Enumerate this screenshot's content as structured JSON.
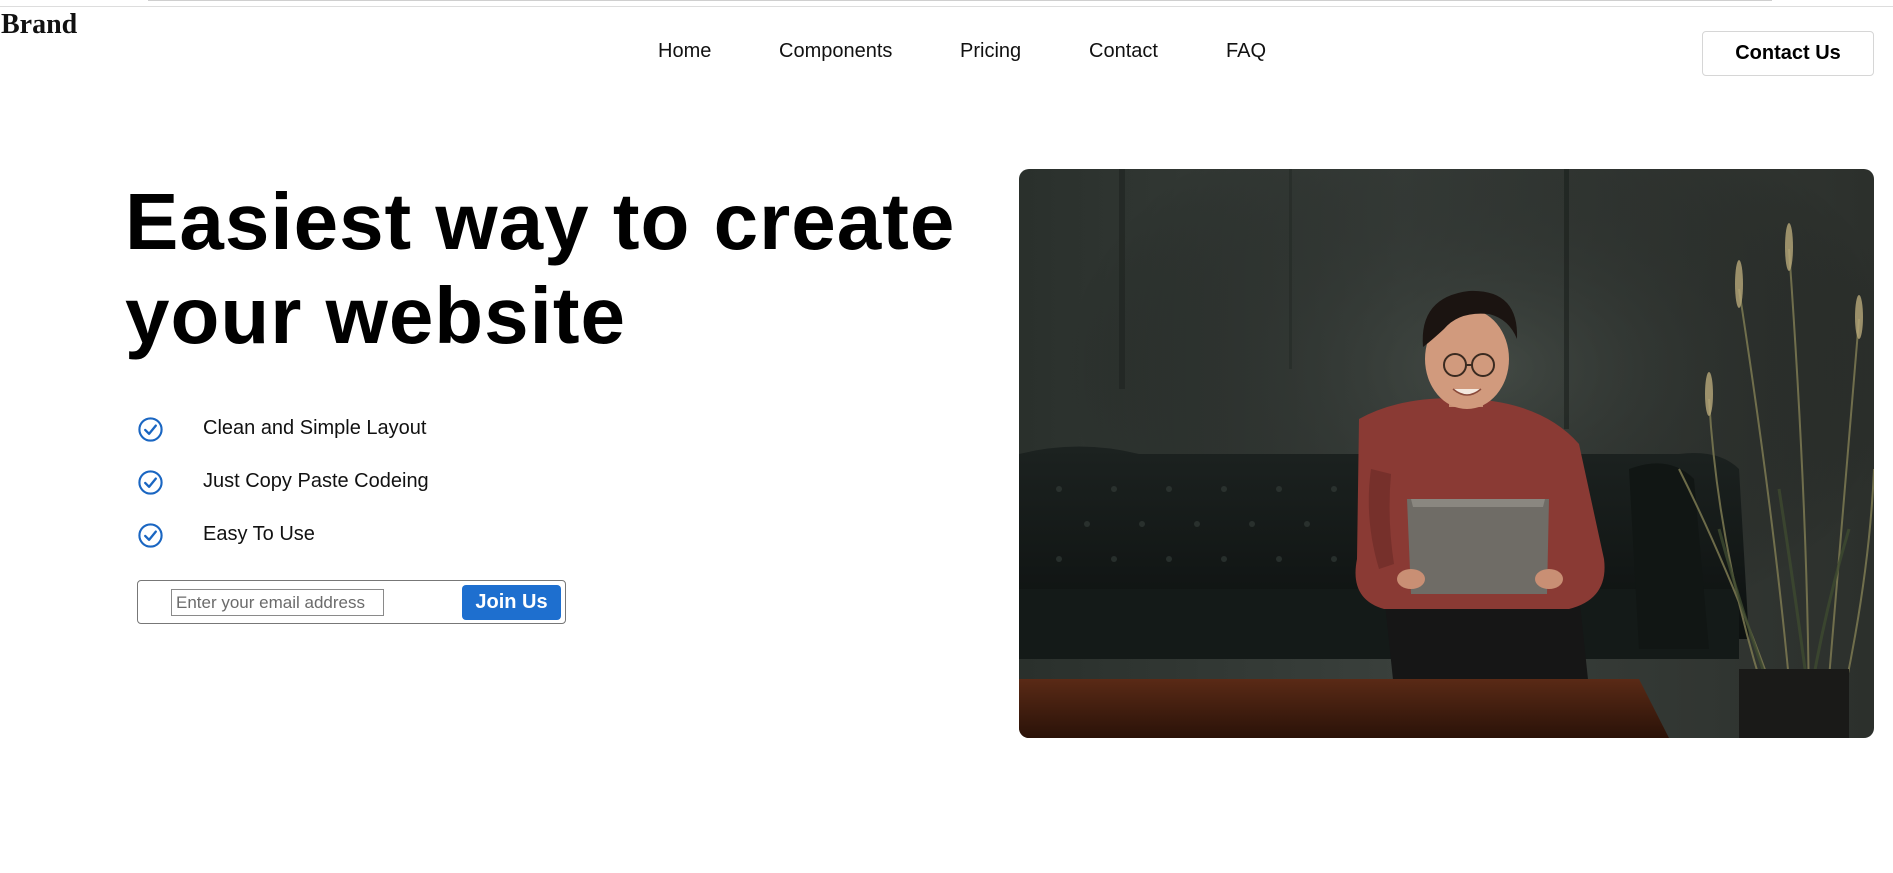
{
  "brand": "Brand",
  "nav": {
    "items": [
      {
        "label": "Home"
      },
      {
        "label": "Components"
      },
      {
        "label": "Pricing"
      },
      {
        "label": "Contact"
      },
      {
        "label": "FAQ"
      }
    ],
    "cta_label": "Contact Us"
  },
  "hero": {
    "title_line1": "Easiest way to create",
    "title_line2": "your website",
    "features": [
      {
        "label": "Clean and Simple Layout",
        "icon": "check-circle-icon"
      },
      {
        "label": "Just Copy Paste Codeing",
        "icon": "check-circle-icon"
      },
      {
        "label": "Easy To Use",
        "icon": "check-circle-icon"
      }
    ],
    "signup": {
      "email_placeholder": "Enter your email address",
      "email_value": "",
      "button_label": "Join Us"
    },
    "image": {
      "subject": "person-with-laptop-on-sofa"
    }
  },
  "colors": {
    "accent": "#1e6fcf",
    "check_icon": "#1a66c2",
    "text": "#111111",
    "background": "#ffffff"
  }
}
